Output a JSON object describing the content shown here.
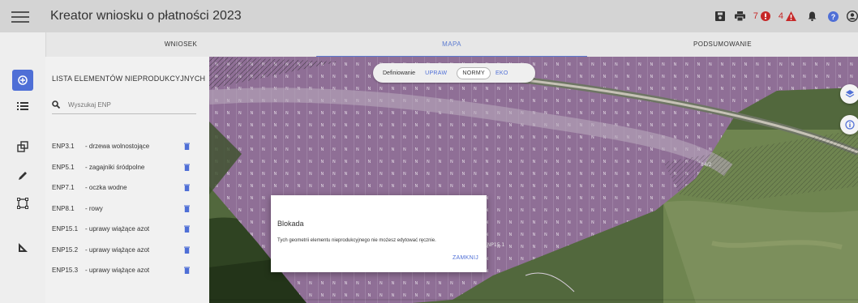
{
  "header": {
    "title": "Kreator wniosku o płatności 2023",
    "menu_icon": "hamburger-menu-icon",
    "icons": [
      {
        "name": "save-icon"
      },
      {
        "name": "print-icon"
      },
      {
        "name": "error-count",
        "count": "7"
      },
      {
        "name": "warning-count",
        "count": "4"
      },
      {
        "name": "notifications-icon"
      },
      {
        "name": "help-icon"
      },
      {
        "name": "account-icon"
      }
    ],
    "colors": {
      "error": "#c62828",
      "accent": "#4f6fd6"
    }
  },
  "tabs": [
    {
      "label": "WNIOSEK",
      "active": false
    },
    {
      "label": "MAPA",
      "active": true
    },
    {
      "label": "PODSUMOWANIE",
      "active": false
    }
  ],
  "rail": [
    "layers-stack-icon",
    "list-icon",
    "copy-shapes-icon",
    "pencil-icon",
    "select-area-icon",
    "measure-triangle-icon"
  ],
  "panel": {
    "title": "LISTA ELEMENTÓW NIEPRODUKCYJNYCH",
    "search_placeholder": "Wyszukaj ENP",
    "items": [
      {
        "code": "ENP3.1",
        "name": "- drzewa wolnostojące"
      },
      {
        "code": "ENP5.1",
        "name": "- zagajniki śródpolne"
      },
      {
        "code": "ENP7.1",
        "name": "- oczka wodne"
      },
      {
        "code": "ENP8.1",
        "name": "- rowy"
      },
      {
        "code": "ENP15.1",
        "name": "- uprawy wiążące azot"
      },
      {
        "code": "ENP15.2",
        "name": "- uprawy wiążące azot"
      },
      {
        "code": "ENP15.3",
        "name": "- uprawy wiążące azot"
      }
    ]
  },
  "map": {
    "defining": {
      "label": "Definiowanie",
      "options": [
        {
          "label": "UPRAW",
          "selected": false
        },
        {
          "label": "NORMY",
          "selected": true
        },
        {
          "label": "EKO",
          "selected": false
        }
      ]
    },
    "hatch_letter": "N",
    "labels": {
      "parcel": "84/2",
      "enp": "ENP15.1"
    },
    "fab_layers": "layers-icon",
    "fab_info": "info-icon"
  },
  "dialog": {
    "title": "Blokada",
    "message": "Tych geometrii elementu nieprodukcyjnego nie możesz edytować ręcznie.",
    "close_label": "ZAMKNIJ"
  }
}
